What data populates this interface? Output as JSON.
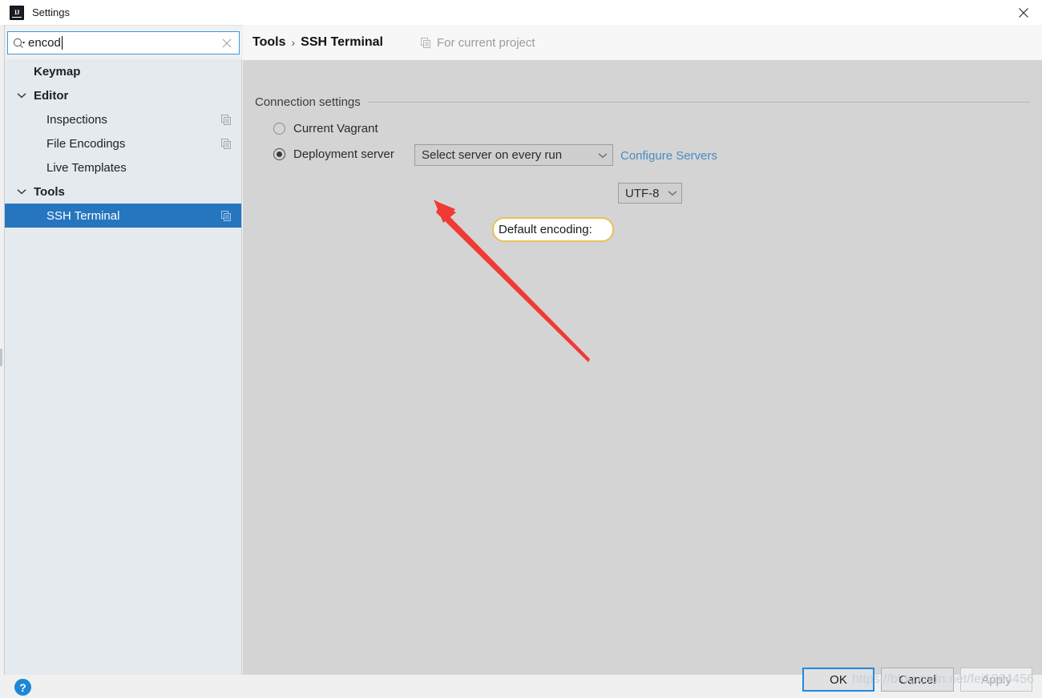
{
  "window": {
    "title": "Settings",
    "app_icon": "IJ",
    "close_icon": "close-icon"
  },
  "search": {
    "value": "encod",
    "placeholder": "",
    "icon": "search-icon",
    "clear_icon": "clear-icon"
  },
  "sidebar": {
    "items": [
      {
        "label": "Keymap",
        "level": "group",
        "chevron": "",
        "badge": false,
        "selected": false
      },
      {
        "label": "Editor",
        "level": "group",
        "chevron": "chevron-down",
        "badge": false,
        "selected": false
      },
      {
        "label": "Inspections",
        "level": "child",
        "chevron": "",
        "badge": true,
        "selected": false
      },
      {
        "label": "File Encodings",
        "level": "child",
        "chevron": "",
        "badge": true,
        "selected": false
      },
      {
        "label": "Live Templates",
        "level": "child",
        "chevron": "",
        "badge": false,
        "selected": false
      },
      {
        "label": "Tools",
        "level": "group",
        "chevron": "chevron-down",
        "badge": false,
        "selected": false
      },
      {
        "label": "SSH Terminal",
        "level": "child",
        "chevron": "",
        "badge": true,
        "selected": true
      }
    ]
  },
  "header": {
    "breadcrumb_parent": "Tools",
    "breadcrumb_separator": "›",
    "breadcrumb_current": "SSH Terminal",
    "scope_note": "For current project",
    "scope_icon": "project-scope-icon"
  },
  "main": {
    "group_title": "Connection settings",
    "radios": [
      {
        "label": "Current Vagrant",
        "checked": false
      },
      {
        "label": "Deployment server",
        "checked": true
      }
    ],
    "server_combo": {
      "value": "Select server on every run",
      "arrow_icon": "chevron-down-icon"
    },
    "configure_link": "Configure Servers",
    "encoding_label": "Default encoding:",
    "encoding_combo": {
      "value": "UTF-8",
      "arrow_icon": "chevron-down-icon"
    }
  },
  "annotation": {
    "highlight_color": "#e8c257",
    "arrow_color": "#f03a34",
    "arrow_target": "encoding-dropdown"
  },
  "footer": {
    "help_label": "?",
    "ok_label": "OK",
    "cancel_label": "Cancel",
    "apply_label": "Apply",
    "watermark": "https://blog.csdn.net/fei1264456"
  }
}
